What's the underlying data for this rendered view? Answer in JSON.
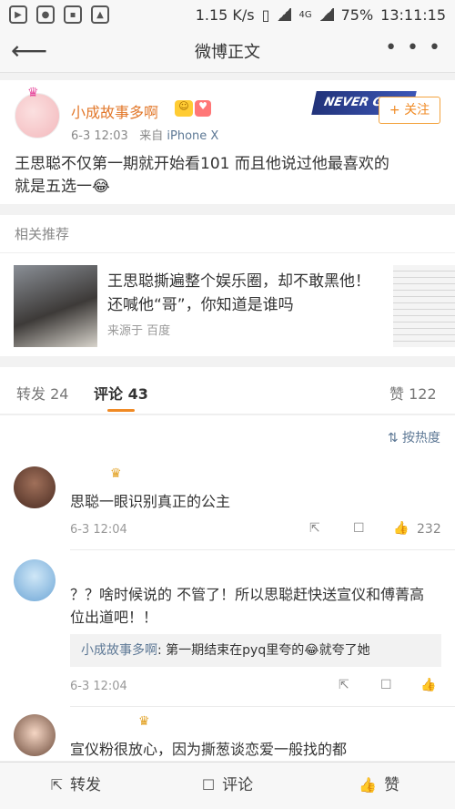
{
  "status": {
    "speed": "1.15 K/s",
    "network": "4G",
    "battery": "75%",
    "time": "13:11:15"
  },
  "nav": {
    "title": "微博正文",
    "more": "• • •"
  },
  "post": {
    "username": "小成故事多啊",
    "date": "6-3 12:03",
    "source_prefix": "来自",
    "source": "iPhone X",
    "banner": "NEVER GIVE UP",
    "follow_label": "+ 关注",
    "text": "王思聪不仅第一期就开始看101 而且他说过他最喜欢的就是五选一😂"
  },
  "related": {
    "header": "相关推荐",
    "title": "王思聪撕遍整个娱乐圈，却不敢黑他！还喊他“哥”，你知道是谁吗",
    "source": "来源于 百度"
  },
  "tabs": {
    "repost": "转发 24",
    "comment": "评论 43",
    "like": "赞 122"
  },
  "sort": {
    "label": "按热度"
  },
  "comments": [
    {
      "text": "思聪一眼识别真正的公主",
      "time": "6-3 12:04",
      "likes": "232"
    },
    {
      "text": "？？啥时候说的 不管了！所以思聪赶快送宣仪和傅菁高位出道吧！！",
      "time": "6-3 12:04",
      "reply_name": "小成故事多啊",
      "reply_text": ": 第一期结束在pyq里夸的😂就夸了她"
    },
    {
      "text": "宣仪粉很放心，因为撕葱谈恋爱一般找的都"
    }
  ],
  "bottom": {
    "repost": "转发",
    "comment": "评论",
    "like": "赞"
  }
}
